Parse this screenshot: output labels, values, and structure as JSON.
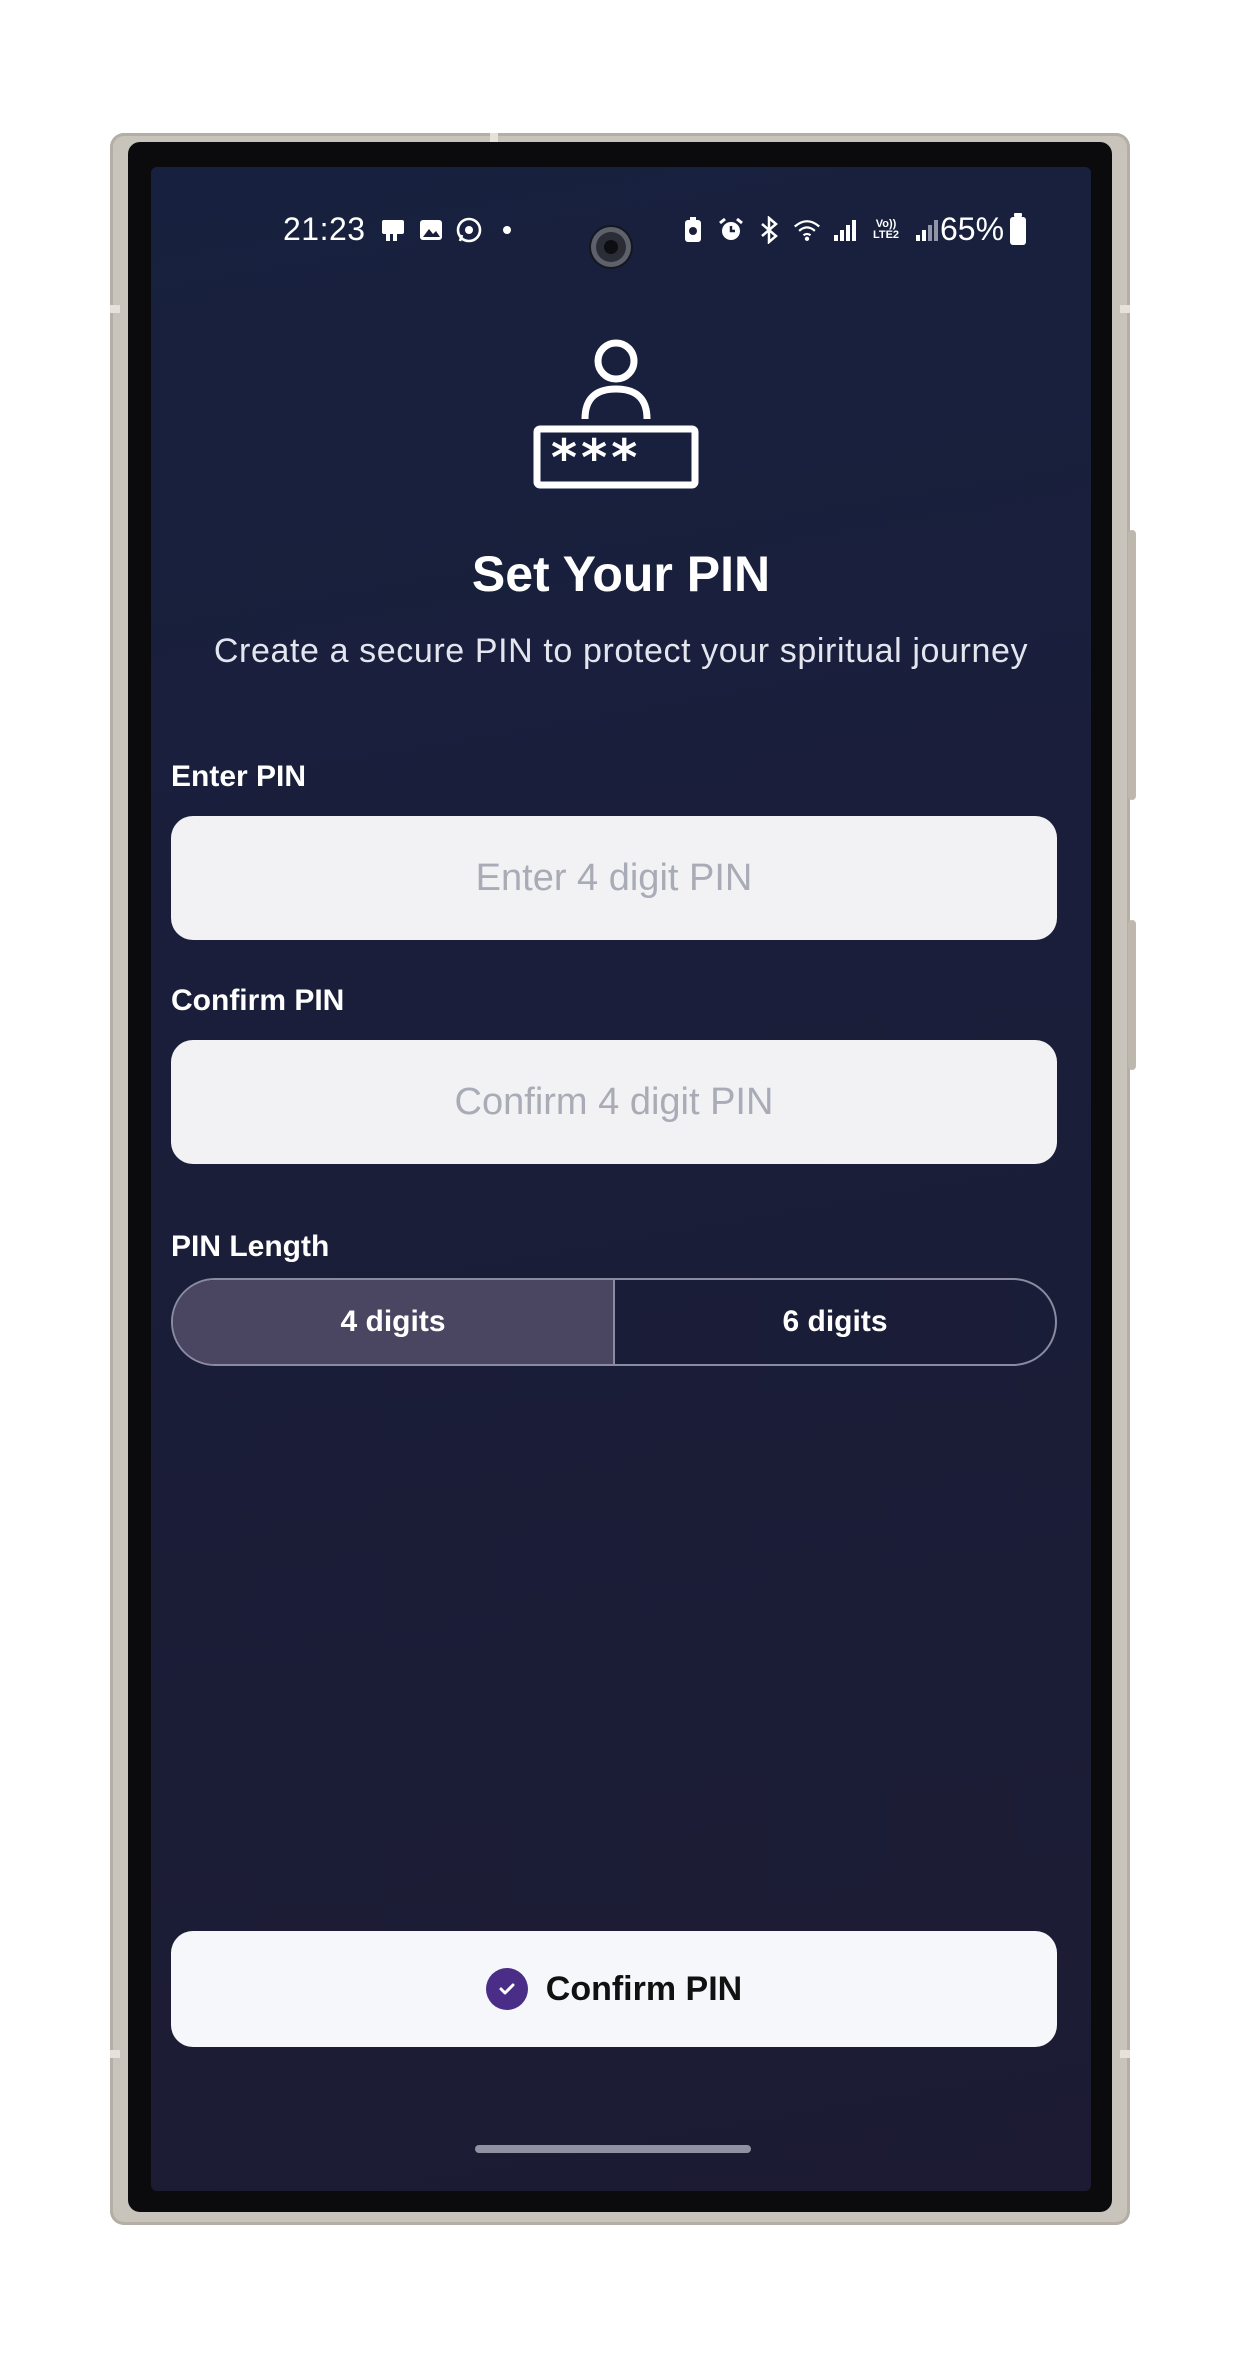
{
  "status_bar": {
    "time": "21:23",
    "left_icons": [
      "message-icon",
      "gallery-icon",
      "whatsapp-icon",
      "dot-icon"
    ],
    "right_icons": [
      "battery-saver-icon",
      "alarm-icon",
      "bluetooth-icon",
      "wifi-icon",
      "signal-icon",
      "volte-lte2-icon",
      "signal-2-icon"
    ],
    "volte_text": "Vo)) LTE2",
    "battery_text": "65%"
  },
  "header": {
    "icon": "user-pin-icon",
    "pin_mask": "***_",
    "title": "Set Your PIN",
    "subtitle": "Create a secure PIN to protect your spiritual journey"
  },
  "form": {
    "enter_pin": {
      "label": "Enter PIN",
      "placeholder": "Enter 4 digit PIN",
      "value": ""
    },
    "confirm_pin": {
      "label": "Confirm PIN",
      "placeholder": "Confirm 4 digit PIN",
      "value": ""
    },
    "pin_length": {
      "label": "PIN Length",
      "options": [
        "4 digits",
        "6 digits"
      ],
      "selected": "4 digits"
    }
  },
  "actions": {
    "confirm_label": "Confirm PIN",
    "confirm_icon": "check-circle-icon"
  },
  "colors": {
    "screen_background": "#1a1e3a",
    "segment_active": "#4a4560",
    "confirm_icon": "#4a2d86"
  }
}
